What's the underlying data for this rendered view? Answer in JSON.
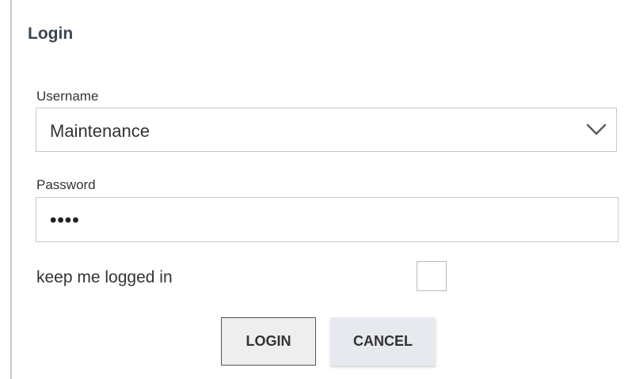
{
  "dialog": {
    "title": "Login"
  },
  "username": {
    "label": "Username",
    "value": "Maintenance",
    "icon": "chevron-down-icon"
  },
  "password": {
    "label": "Password",
    "value": "••••"
  },
  "keep_logged_in": {
    "label": "keep me logged in",
    "checked": false
  },
  "buttons": {
    "login_label": "LOGIN",
    "cancel_label": "CANCEL"
  },
  "colors": {
    "title": "#3a4654",
    "field_border": "#c4c8cc",
    "login_border": "#4f5760",
    "cancel_bg": "#e6e9ed"
  }
}
